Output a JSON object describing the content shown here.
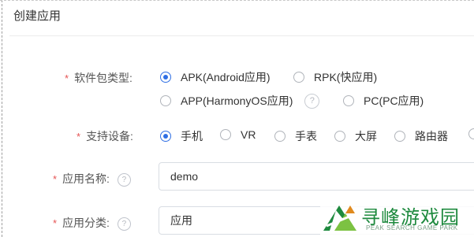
{
  "page": {
    "title": "创建应用"
  },
  "form": {
    "package_type": {
      "label": "软件包类型:",
      "options": [
        {
          "label": "APK(Android应用)",
          "checked": true
        },
        {
          "label": "RPK(快应用)",
          "checked": false
        },
        {
          "label": "APP(HarmonyOS应用)",
          "checked": false,
          "help_icon": "?"
        },
        {
          "label": "PC(PC应用)",
          "checked": false
        }
      ]
    },
    "devices": {
      "label": "支持设备:",
      "options": [
        {
          "label": "手机",
          "checked": true
        },
        {
          "label": "VR",
          "checked": false
        },
        {
          "label": "手表",
          "checked": false
        },
        {
          "label": "大屏",
          "checked": false
        },
        {
          "label": "路由器",
          "checked": false
        }
      ]
    },
    "app_name": {
      "label": "应用名称:",
      "help_icon": "?",
      "value": "demo"
    },
    "app_category": {
      "label": "应用分类:",
      "help_icon": "?",
      "value": "应用"
    },
    "required_mark": "*"
  },
  "watermark": {
    "name": "寻峰游戏园",
    "subtitle": "PEAK SEARCH GAME PARK",
    "color": "#1e8a3e"
  },
  "colors": {
    "accent": "#2f6fe4",
    "required": "#e55353"
  }
}
